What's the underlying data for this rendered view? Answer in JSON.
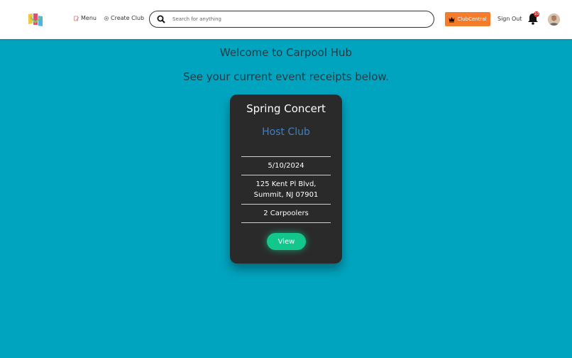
{
  "nav": {
    "menu_label": "Menu",
    "create_club_label": "Create Club"
  },
  "search": {
    "placeholder": "Search for anything"
  },
  "header_actions": {
    "clubcentral_label": "ClubCentral",
    "signout_label": "Sign Out",
    "notification_count": "10"
  },
  "main": {
    "welcome": "Welcome to Carpool Hub",
    "subtitle": "See your current event receipts below."
  },
  "card": {
    "title": "Spring Concert",
    "host": "Host Club",
    "date": "5/10/2024",
    "address_line1": "125 Kent Pl Blvd,",
    "address_line2": "Summit, NJ 07901",
    "carpoolers": "2 Carpoolers",
    "view_label": "View"
  },
  "colors": {
    "background": "#00a4bf",
    "card": "#2a2a2a",
    "host_link": "#3b82c4",
    "view_button": "#12c68c",
    "clubcentral": "#f57c2a"
  }
}
